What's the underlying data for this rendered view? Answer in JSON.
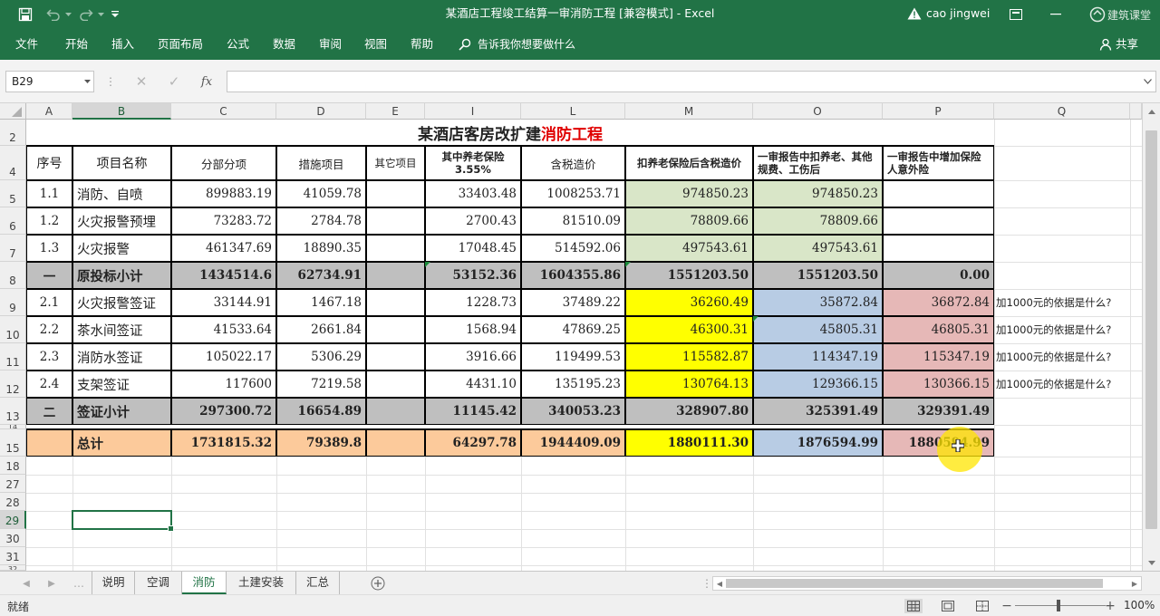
{
  "window": {
    "title": "某酒店工程竣工结算一审消防工程  [兼容模式]  -  Excel",
    "user": "cao jingwei",
    "watermark": "建筑课堂"
  },
  "menu": [
    "文件",
    "开始",
    "插入",
    "页面布局",
    "公式",
    "数据",
    "审阅",
    "视图",
    "帮助"
  ],
  "tell_me": "告诉我你想要做什么",
  "share": "共享",
  "formula_bar": {
    "name_box": "B29",
    "fx": "fx",
    "formula": ""
  },
  "columns": [
    "A",
    "B",
    "C",
    "D",
    "E",
    "I",
    "L",
    "M",
    "O",
    "P",
    "Q"
  ],
  "selected_column": "B",
  "rows": [
    "2",
    "4",
    "5",
    "6",
    "7",
    "8",
    "9",
    "10",
    "11",
    "12",
    "13",
    "14",
    "15",
    "18",
    "27",
    "28",
    "29",
    "30",
    "31",
    "32"
  ],
  "selected_row": "29",
  "sheet": {
    "title_black": "某酒店客房改扩建",
    "title_red": "消防工程",
    "header": [
      "序号",
      "项目名称",
      "分部分项",
      "措施项目",
      "其它项目",
      "其中养老保险3.55%",
      "含税造价",
      "扣养老保险后含税造价",
      "一审报告中扣养老、其他规费、工伤后",
      "一审报告中增加保险人意外险"
    ],
    "data_rows": [
      [
        "1.1",
        "消防、自喷",
        "899883.19",
        "41059.78",
        "",
        "33403.48",
        "1008253.71",
        "974850.23",
        "974850.23",
        ""
      ],
      [
        "1.2",
        "火灾报警预埋",
        "73283.72",
        "2784.78",
        "",
        "2700.43",
        "81510.09",
        "78809.66",
        "78809.66",
        ""
      ],
      [
        "1.3",
        "火灾报警",
        "461347.69",
        "18890.35",
        "",
        "17048.45",
        "514592.06",
        "497543.61",
        "497543.61",
        ""
      ],
      [
        "一",
        "原投标小计",
        "1434514.6",
        "62734.91",
        "",
        "53152.36",
        "1604355.86",
        "1551203.50",
        "1551203.50",
        "0.00"
      ],
      [
        "2.1",
        "火灾报警签证",
        "33144.91",
        "1467.18",
        "",
        "1228.73",
        "37489.22",
        "36260.49",
        "35872.84",
        "36872.84"
      ],
      [
        "2.2",
        "茶水间签证",
        "41533.64",
        "2661.84",
        "",
        "1568.94",
        "47869.25",
        "46300.31",
        "45805.31",
        "46805.31"
      ],
      [
        "2.3",
        "消防水签证",
        "105022.17",
        "5306.29",
        "",
        "3916.66",
        "119499.53",
        "115582.87",
        "114347.19",
        "115347.19"
      ],
      [
        "2.4",
        "支架签证",
        "117600",
        "7219.58",
        "",
        "4431.10",
        "135195.23",
        "130764.13",
        "129366.15",
        "130366.15"
      ],
      [
        "二",
        "签证小计",
        "297300.72",
        "16654.89",
        "",
        "11145.42",
        "340053.23",
        "328907.80",
        "325391.49",
        "329391.49"
      ]
    ],
    "total_row": [
      "",
      "总计",
      "1731815.32",
      "79389.8",
      "",
      "64297.78",
      "1944409.09",
      "1880111.30",
      "1876594.99",
      "1880594.99"
    ],
    "notes": [
      "加1000元的依据是什么?",
      "加1000元的依据是什么?",
      "加1000元的依据是什么?",
      "加1000元的依据是什么?"
    ],
    "colors": {
      "green": "#d9e6c8",
      "gray": "#bfbfbf",
      "yellow": "#ffff00",
      "blue": "#b8cce4",
      "pink": "#e6b8b7",
      "orange": "#fcca9b",
      "red": "#e00000"
    }
  },
  "sheet_tabs": [
    "说明",
    "空调",
    "消防",
    "土建安装",
    "汇总"
  ],
  "active_tab": "消防",
  "status": {
    "mode": "就绪",
    "zoom": "100%"
  }
}
